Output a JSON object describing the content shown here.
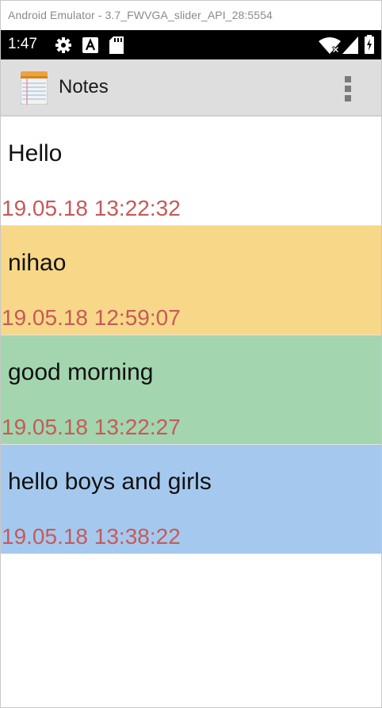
{
  "window": {
    "title": "Android Emulator - 3.7_FWVGA_slider_API_28:5554"
  },
  "status_bar": {
    "time": "1:47",
    "icons": [
      "settings-gear-icon",
      "font-a-icon",
      "sd-card-icon",
      "wifi-icon",
      "battery-icon"
    ]
  },
  "app_bar": {
    "title": "Notes",
    "logo_icon": "notepad-icon",
    "menu_icon": "overflow-menu-icon"
  },
  "notes": [
    {
      "title": "Hello",
      "time": "19.05.18 13:22:32",
      "color": "#ffffff"
    },
    {
      "title": "nihao",
      "time": "19.05.18 12:59:07",
      "color": "#f7d788"
    },
    {
      "title": "good morning",
      "time": "19.05.18 13:22:27",
      "color": "#a3d5ae"
    },
    {
      "title": "hello boys and girls",
      "time": "19.05.18 13:38:22",
      "color": "#a5c9ee"
    }
  ],
  "colors": {
    "timestamp": "#c65a5a",
    "app_bar_bg": "#dedede",
    "status_bar_bg": "#000000"
  }
}
